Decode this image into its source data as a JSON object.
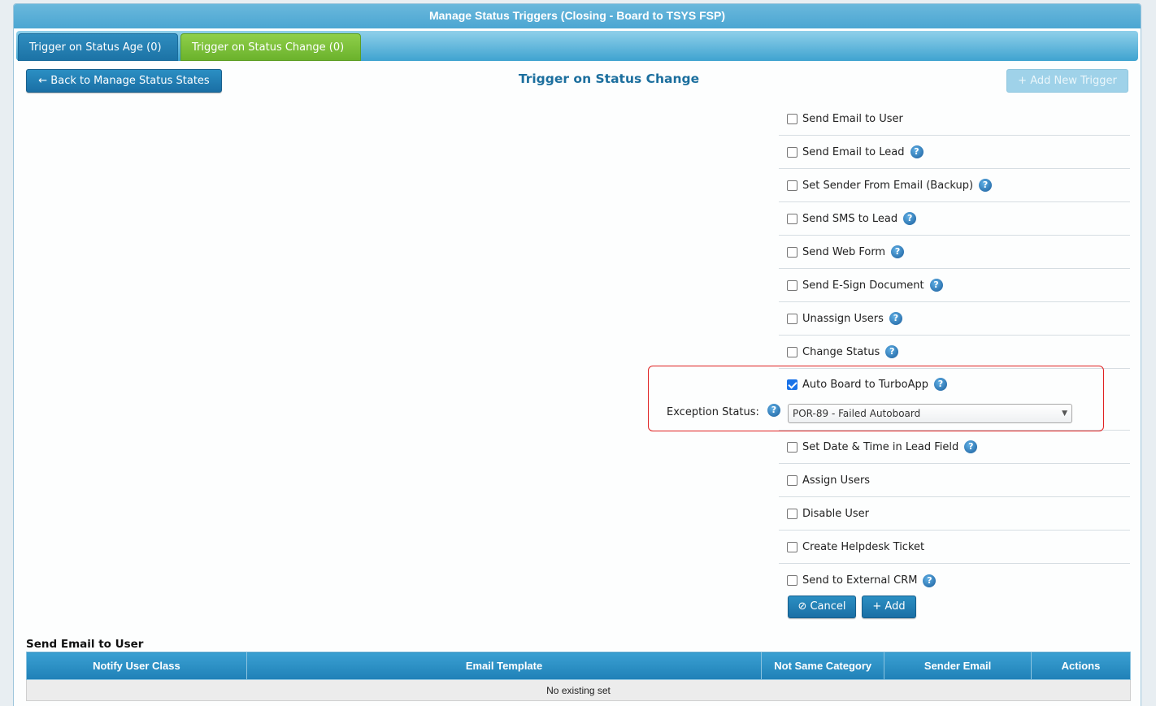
{
  "dialog": {
    "title": "Manage Status Triggers (Closing - Board to TSYS FSP)"
  },
  "tabs": [
    {
      "label": "Trigger on Status Age (0)",
      "active": false
    },
    {
      "label": "Trigger on Status Change (0)",
      "active": true
    }
  ],
  "toolbar": {
    "back_label": "← Back to Manage Status States",
    "heading": "Trigger on Status Change",
    "add_trigger_label": "+ Add New Trigger"
  },
  "options": [
    {
      "label": "Send Email to User",
      "checked": false,
      "help": false
    },
    {
      "label": "Send Email to Lead",
      "checked": false,
      "help": true
    },
    {
      "label": "Set Sender From Email (Backup)",
      "checked": false,
      "help": true
    },
    {
      "label": "Send SMS to Lead",
      "checked": false,
      "help": true
    },
    {
      "label": "Send Web Form",
      "checked": false,
      "help": true
    },
    {
      "label": "Send E-Sign Document",
      "checked": false,
      "help": true
    },
    {
      "label": "Unassign Users",
      "checked": false,
      "help": true
    },
    {
      "label": "Change Status",
      "checked": false,
      "help": true
    },
    {
      "label": "Auto Board to TurboApp",
      "checked": true,
      "help": true
    },
    {
      "label": "Set Date & Time in Lead Field",
      "checked": false,
      "help": true
    },
    {
      "label": "Assign Users",
      "checked": false,
      "help": false
    },
    {
      "label": "Disable User",
      "checked": false,
      "help": false
    },
    {
      "label": "Create Helpdesk Ticket",
      "checked": false,
      "help": false
    },
    {
      "label": "Send to External CRM",
      "checked": false,
      "help": true
    }
  ],
  "exception": {
    "label": "Exception Status:",
    "selected": "POR-89 - Failed Autoboard"
  },
  "actions": {
    "cancel_label": "⊘ Cancel",
    "add_label": "+ Add"
  },
  "email_section": {
    "title": "Send Email to User",
    "columns": [
      "Notify User Class",
      "Email Template",
      "Not Same Category",
      "Sender Email",
      "Actions"
    ],
    "empty_text": "No existing set"
  },
  "colors": {
    "accent": "#1f80b7",
    "active_tab": "#6bb22c",
    "highlight": "#e02020"
  }
}
